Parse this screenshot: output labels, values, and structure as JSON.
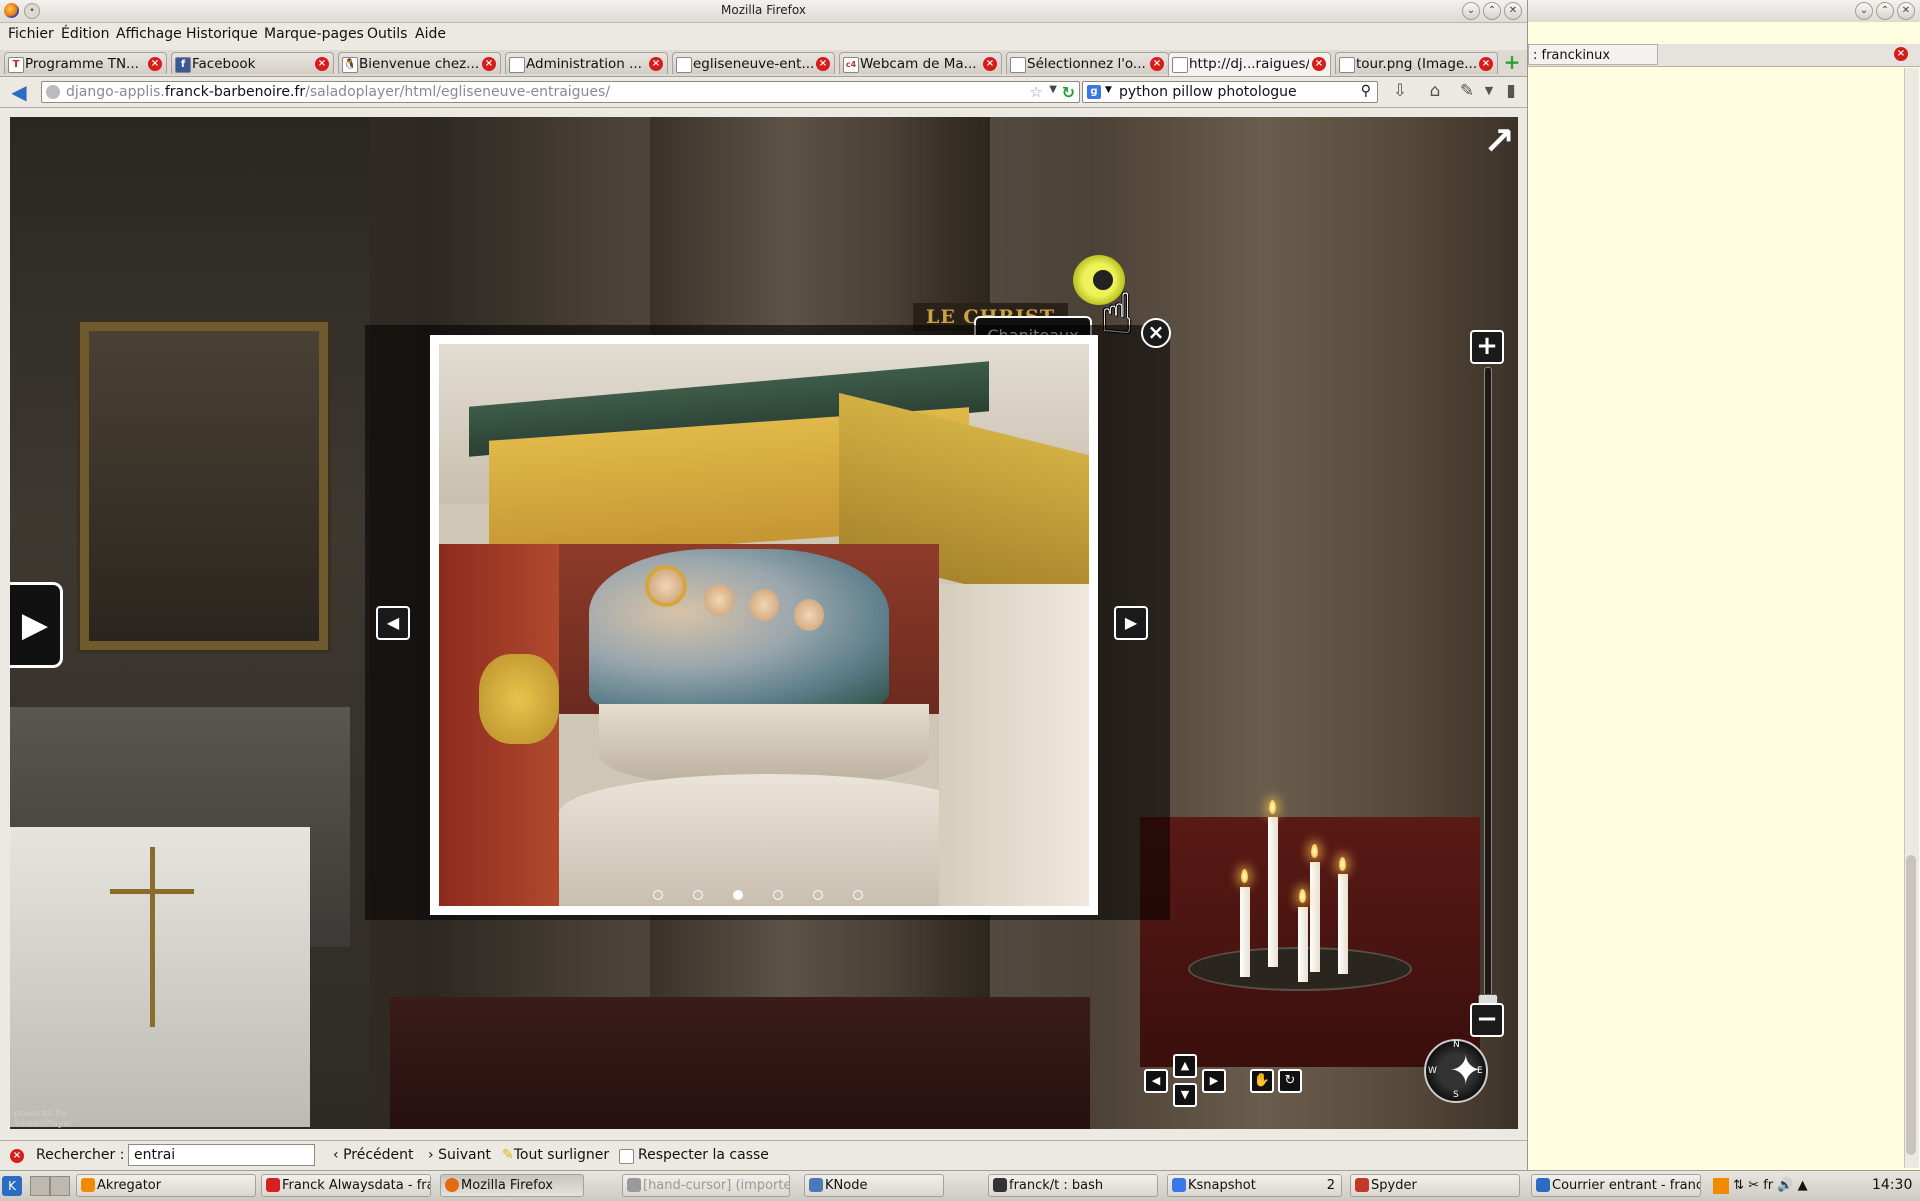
{
  "window": {
    "title": "Mozilla Firefox"
  },
  "menubar": [
    {
      "label": "Fichier"
    },
    {
      "label": "Édition"
    },
    {
      "label": "Affichage"
    },
    {
      "label": "Historique"
    },
    {
      "label": "Marque-pages"
    },
    {
      "label": "Outils"
    },
    {
      "label": "Aide"
    }
  ],
  "tabs": [
    {
      "label": "Programme TN...",
      "favicon": "T",
      "favicon_color": "#d42020"
    },
    {
      "label": "Facebook",
      "favicon": "f",
      "favicon_color": "#3b5998"
    },
    {
      "label": "Bienvenue chez...",
      "favicon": "penguin-icon",
      "favicon_color": "#222222"
    },
    {
      "label": "Administration ...",
      "favicon": "",
      "favicon_color": "#ffffff"
    },
    {
      "label": "egliseneuve-ent...",
      "favicon": "",
      "favicon_color": "#ffffff"
    },
    {
      "label": "Webcam de Ma...",
      "favicon": "c4",
      "favicon_color": "#c0392b"
    },
    {
      "label": "Sélectionnez l'o...",
      "favicon": "",
      "favicon_color": "#ffffff"
    },
    {
      "label": "http://dj...raigues/",
      "favicon": "",
      "favicon_color": "#ffffff",
      "active": true
    },
    {
      "label": "tour.png (Image...",
      "favicon": "",
      "favicon_color": "#ffffff"
    }
  ],
  "navbar": {
    "url_host_prefix": "django-applis.",
    "url_host": "franck-barbenoire.fr",
    "url_path": "/saladoplayer/html/egliseneuve-entraigues/",
    "search_text": "python pillow photologue"
  },
  "viewer": {
    "sign_text": "LE CHRIST",
    "hotspot_tooltip": "Chapiteaux",
    "powered_by_line1": "powered by",
    "powered_by_line2": "SaladoPlayer",
    "gallery_dots_count": 6,
    "gallery_active_dot": 3,
    "compass_labels": [
      "N",
      "E",
      "S",
      "W"
    ]
  },
  "findbar": {
    "label": "Rechercher :",
    "input_value": "entrai",
    "previous_label": "Précédent",
    "next_label": "Suivant",
    "highlight_label": "Tout surligner",
    "match_case_label": "Respecter la casse"
  },
  "rightpane": {
    "tab_label": ": franckinux"
  },
  "taskbar": {
    "tasks": [
      {
        "label": "Akregator",
        "icon_color": "#f08a00"
      },
      {
        "label": "Franck Alwaysdata - fra",
        "icon_color": "#d42020"
      },
      {
        "label": "Mozilla Firefox",
        "icon_color": "#e46a12",
        "active": true
      },
      {
        "label": "[hand-cursor] (importe",
        "icon_color": "#999999",
        "dim": true
      },
      {
        "label": "KNode",
        "icon_color": "#4a7ab8"
      },
      {
        "label": "franck/t : bash",
        "icon_color": "#333333"
      },
      {
        "label": "Ksnapshot",
        "icon_color": "#3b78e7",
        "badge": "2"
      },
      {
        "label": "Spyder",
        "icon_color": "#c0392b"
      },
      {
        "label": "Courrier entrant - franc",
        "icon_color": "#2a6bc4"
      }
    ],
    "keyboard_layout": "fr",
    "clock": "14:30"
  }
}
